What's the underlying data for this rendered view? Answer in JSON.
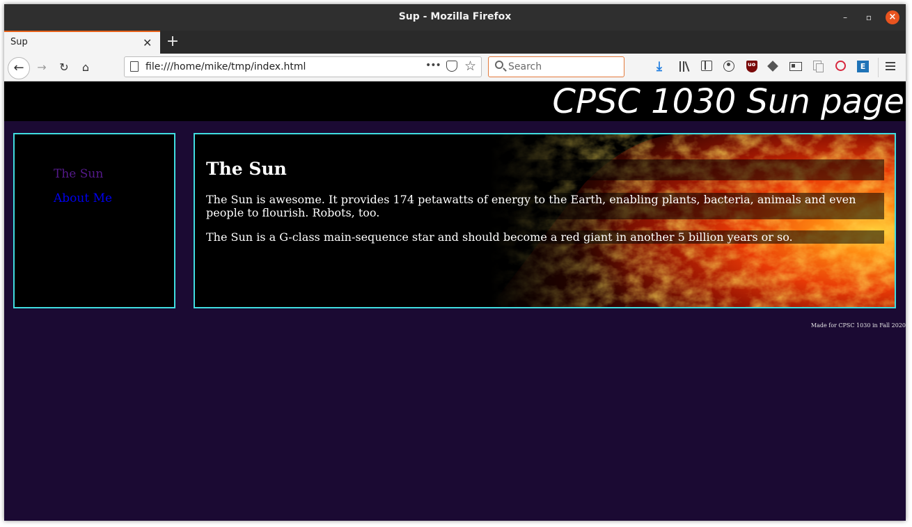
{
  "window": {
    "title": "Sup - Mozilla Firefox",
    "controls": {
      "minimize": "–",
      "maximize": "▫",
      "close": "×"
    }
  },
  "tabs": [
    {
      "label": "Sup",
      "close": "✕",
      "active": true
    }
  ],
  "tabbar": {
    "new_tab": "+"
  },
  "navbar": {
    "back": "←",
    "forward": "→",
    "reload": "↻",
    "home": "⌂",
    "url": "file:///home/mike/tmp/index.html",
    "page_actions": "•••",
    "bookmark_star": "☆"
  },
  "search": {
    "placeholder": "Search"
  },
  "toolbar_icons": [
    "download-icon",
    "library-icon",
    "sidebar-icon",
    "account-icon",
    "ublock-icon",
    "cube-extension-icon",
    "reader-extension-icon",
    "copy-extension-icon",
    "shield-extension-icon",
    "extension-icon",
    "hamburger-menu-icon"
  ],
  "toolbar": {
    "ext_letter": "E",
    "download_glyph": "⤓"
  },
  "colors": {
    "page_background": "#1b0a33",
    "header_background": "#000000",
    "border_accent": "#40dde0",
    "visited_link": "#551a8b",
    "unvisited_link": "#0000ee",
    "search_focus": "#e3793b",
    "tab_accent": "#e8621a"
  },
  "site": {
    "title": "CPSC 1030 Sun page",
    "nav": [
      {
        "label": "The Sun"
      },
      {
        "label": "About Me"
      }
    ],
    "main": {
      "heading": "The Sun",
      "paragraphs": [
        "The Sun is awesome. It provides 174 petawatts of energy to the Earth, enabling plants, bacteria, animals and even people to flourish. Robots, too.",
        "The Sun is a G-class main-sequence star and should become a red giant in another 5 billion years or so."
      ]
    },
    "footer": "Made for CPSC 1030 in Fall 2020"
  }
}
